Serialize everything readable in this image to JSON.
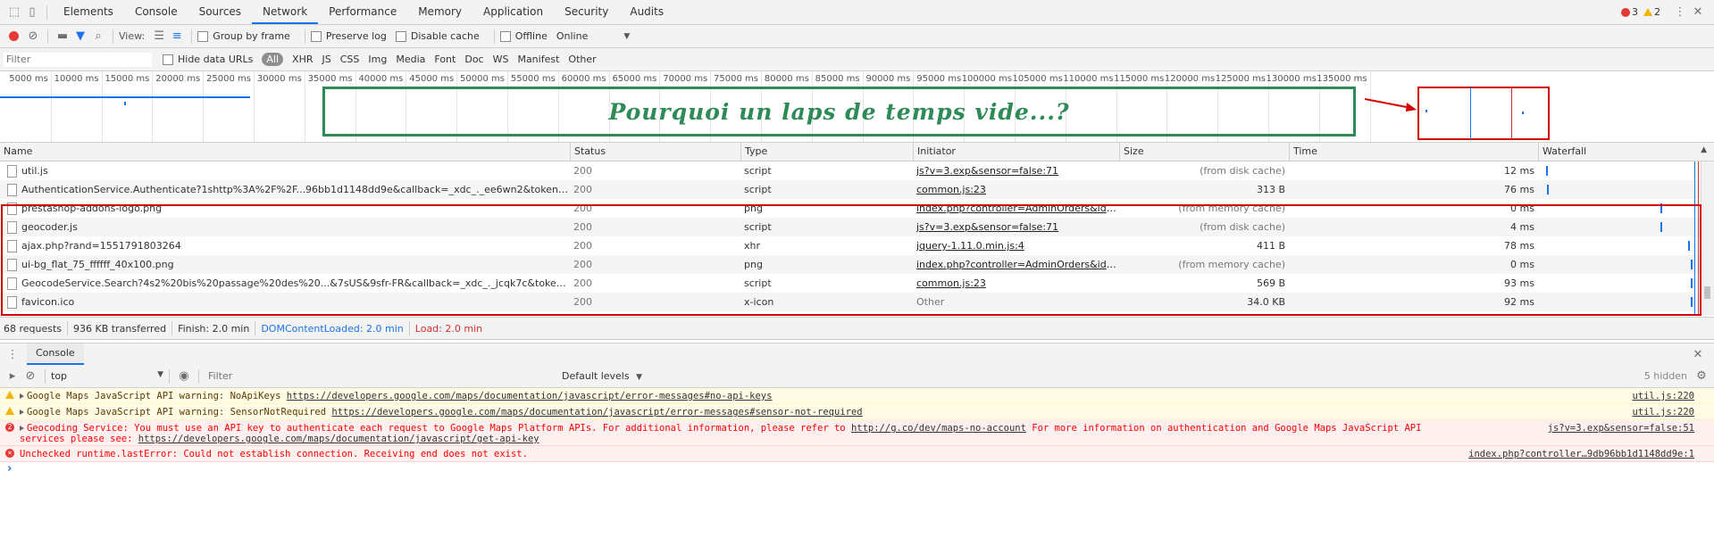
{
  "tabs": [
    "Elements",
    "Console",
    "Sources",
    "Network",
    "Performance",
    "Memory",
    "Application",
    "Security",
    "Audits"
  ],
  "badges": {
    "errors": "3",
    "warnings": "2"
  },
  "toolbar": {
    "view_label": "View:",
    "group_by_frame": "Group by frame",
    "preserve_log": "Preserve log",
    "disable_cache": "Disable cache",
    "offline": "Offline",
    "throttle": "Online"
  },
  "filter": {
    "placeholder": "Filter",
    "hide_data_urls": "Hide data URLs",
    "types": [
      "All",
      "XHR",
      "JS",
      "CSS",
      "Img",
      "Media",
      "Font",
      "Doc",
      "WS",
      "Manifest",
      "Other"
    ]
  },
  "timeline": {
    "ticks": [
      "5000 ms",
      "10000 ms",
      "15000 ms",
      "20000 ms",
      "25000 ms",
      "30000 ms",
      "35000 ms",
      "40000 ms",
      "45000 ms",
      "50000 ms",
      "55000 ms",
      "60000 ms",
      "65000 ms",
      "70000 ms",
      "75000 ms",
      "80000 ms",
      "85000 ms",
      "90000 ms",
      "95000 ms",
      "100000 ms",
      "105000 ms",
      "110000 ms",
      "115000 ms",
      "120000 ms",
      "125000 ms",
      "130000 ms",
      "135000 ms"
    ],
    "annotation": "Pourquoi un laps de temps vide...?"
  },
  "columns": [
    "Name",
    "Status",
    "Type",
    "Initiator",
    "Size",
    "Time",
    "Waterfall"
  ],
  "rows": [
    {
      "name": "util.js",
      "status": "200",
      "type": "script",
      "initiator": "js?v=3.exp&sensor=false:71",
      "initiator_link": true,
      "size": "(from disk cache)",
      "time": "12 ms",
      "wf": 0.05
    },
    {
      "name": "AuthenticationService.Authenticate?1shttp%3A%2F%2F...96bb1d1148dd9e&callback=_xdc_._ee6wn2&token=967...",
      "status": "200",
      "type": "script",
      "initiator": "common.js:23",
      "initiator_link": true,
      "size": "313 B",
      "time": "76 ms",
      "wf": 0.06
    },
    {
      "name": "prestashop-addons-logo.png",
      "status": "200",
      "type": "png",
      "initiator": "index.php?controller=AdminOrders&id_...",
      "initiator_link": true,
      "size": "(from memory cache)",
      "time": "0 ms",
      "wf": 0.79
    },
    {
      "name": "geocoder.js",
      "status": "200",
      "type": "script",
      "initiator": "js?v=3.exp&sensor=false:71",
      "initiator_link": true,
      "size": "(from disk cache)",
      "time": "4 ms",
      "wf": 0.79
    },
    {
      "name": "ajax.php?rand=1551791803264",
      "status": "200",
      "type": "xhr",
      "initiator": "jquery-1.11.0.min.js:4",
      "initiator_link": true,
      "size": "411 B",
      "time": "78 ms",
      "wf": 0.97
    },
    {
      "name": "ui-bg_flat_75_ffffff_40x100.png",
      "status": "200",
      "type": "png",
      "initiator": "index.php?controller=AdminOrders&id_...",
      "initiator_link": true,
      "size": "(from memory cache)",
      "time": "0 ms",
      "wf": 0.99
    },
    {
      "name": "GeocodeService.Search?4s2%20bis%20passage%20des%20...&7sUS&9sfr-FR&callback=_xdc_._jcqk7c&token=11...",
      "status": "200",
      "type": "script",
      "initiator": "common.js:23",
      "initiator_link": true,
      "size": "569 B",
      "time": "93 ms",
      "wf": 0.99
    },
    {
      "name": "favicon.ico",
      "status": "200",
      "type": "x-icon",
      "initiator": "Other",
      "initiator_link": false,
      "size": "34.0 KB",
      "time": "92 ms",
      "wf": 0.99
    }
  ],
  "summary": {
    "requests": "68 requests",
    "transferred": "936 KB transferred",
    "finish": "Finish: 2.0 min",
    "dom": "DOMContentLoaded: 2.0 min",
    "load": "Load: 2.0 min"
  },
  "drawer": {
    "title": "Console",
    "context": "top",
    "filter_placeholder": "Filter",
    "levels": "Default levels",
    "hidden": "5 hidden"
  },
  "console": [
    {
      "level": "warn",
      "text": "Google Maps JavaScript API warning: NoApiKeys ",
      "link": "https://developers.google.com/maps/documentation/javascript/error-messages#no-api-keys",
      "src": "util.js:220"
    },
    {
      "level": "warn",
      "text": "Google Maps JavaScript API warning: SensorNotRequired ",
      "link": "https://developers.google.com/maps/documentation/javascript/error-messages#sensor-not-required",
      "src": "util.js:220"
    },
    {
      "level": "err",
      "count": "2",
      "text": "Geocoding Service: You must use an API key to authenticate each request to Google Maps Platform APIs. For additional information, please refer to ",
      "link": "http://g.co/dev/maps-no-account",
      "text2": " For more information on authentication and Google Maps JavaScript API",
      "line2": "services please see: ",
      "link2": "https://developers.google.com/maps/documentation/javascript/get-api-key",
      "src": "js?v=3.exp&sensor=false:51"
    },
    {
      "level": "err",
      "text": "Unchecked runtime.lastError: Could not establish connection. Receiving end does not exist.",
      "src": "index.php?controller…9db96bb1d1148dd9e:1"
    }
  ],
  "colors": {
    "accent": "#1a73e8",
    "annotation": "#2e8b57",
    "highlight": "#d50000",
    "dom": "#1a73e8",
    "load": "#d32f2f"
  }
}
